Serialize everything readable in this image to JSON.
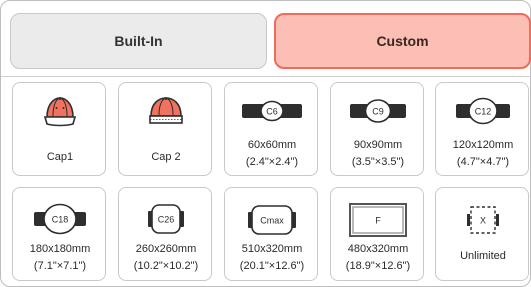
{
  "tabs": {
    "builtin": "Built-In",
    "custom": "Custom"
  },
  "hoops": [
    {
      "icon": "cap-front-icon",
      "label1": "Cap1",
      "label2": ""
    },
    {
      "icon": "cap-back-icon",
      "label1": "Cap 2",
      "label2": ""
    },
    {
      "icon": "hoop-c6-icon",
      "badge": "C6",
      "label1": "60x60mm",
      "label2": "(2.4\"×2.4\")"
    },
    {
      "icon": "hoop-c9-icon",
      "badge": "C9",
      "label1": "90x90mm",
      "label2": "(3.5\"×3.5\")"
    },
    {
      "icon": "hoop-c12-icon",
      "badge": "C12",
      "label1": "120x120mm",
      "label2": "(4.7\"×4.7\")"
    },
    {
      "icon": "hoop-c18-icon",
      "badge": "C18",
      "label1": "180x180mm",
      "label2": "(7.1\"×7.1\")"
    },
    {
      "icon": "hoop-c26-icon",
      "badge": "C26",
      "label1": "260x260mm",
      "label2": "(10.2\"×10.2\")"
    },
    {
      "icon": "hoop-cmax-icon",
      "badge": "Cmax",
      "label1": "510x320mm",
      "label2": "(20.1\"×12.6\")"
    },
    {
      "icon": "hoop-f-icon",
      "badge": "F",
      "label1": "480x320mm",
      "label2": "(18.9\"×12.6\")"
    },
    {
      "icon": "hoop-unlimited-icon",
      "badge": "X",
      "label1": "Unlimited",
      "label2": ""
    }
  ],
  "colors": {
    "accent": "#ef6b5a",
    "accent_fill": "#fcbfb6",
    "cap_red": "#f0725f",
    "dark": "#2e2e2e"
  }
}
